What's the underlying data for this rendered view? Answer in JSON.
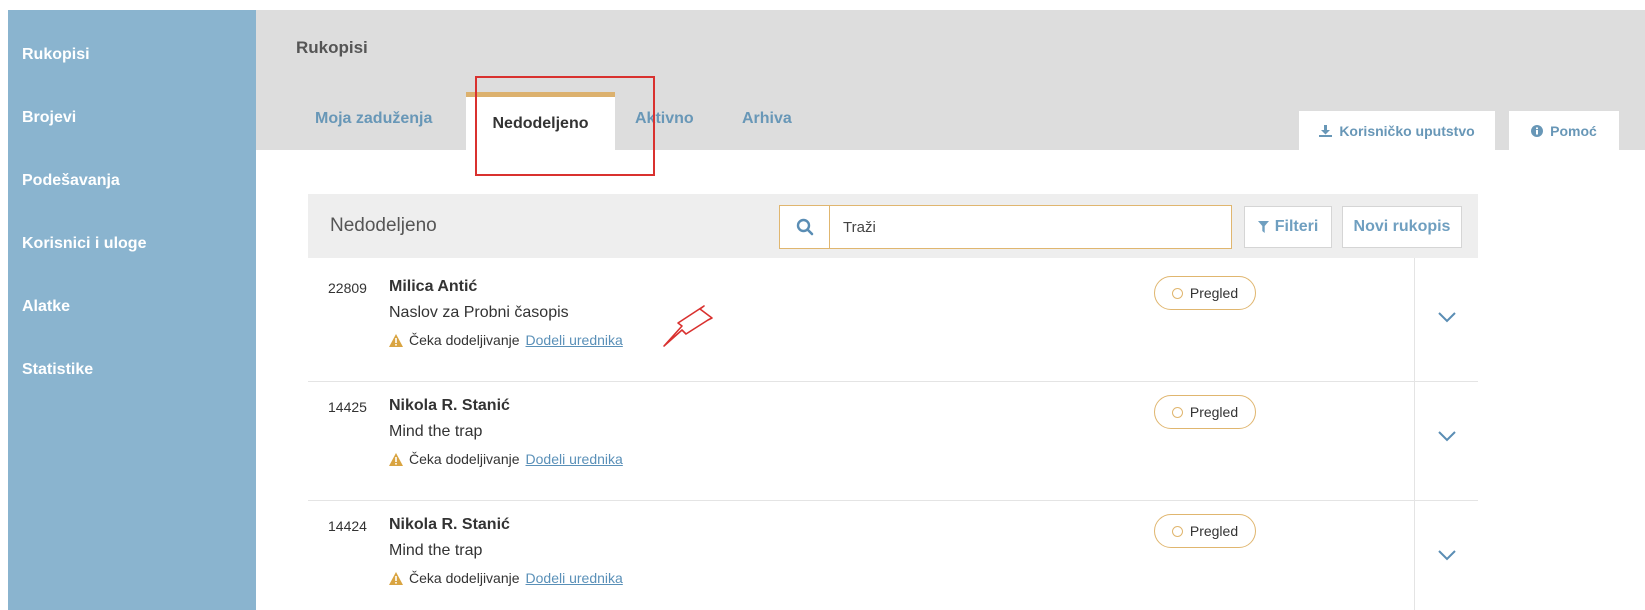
{
  "sidebar": {
    "items": [
      {
        "label": "Rukopisi"
      },
      {
        "label": "Brojevi"
      },
      {
        "label": "Podešavanja"
      },
      {
        "label": "Korisnici i uloge"
      },
      {
        "label": "Alatke"
      },
      {
        "label": "Statistike"
      }
    ]
  },
  "header": {
    "title": "Rukopisi",
    "tabs": [
      {
        "label": "Moja zaduženja"
      },
      {
        "label": "Nedodeljeno"
      },
      {
        "label": "Aktivno"
      },
      {
        "label": "Arhiva"
      }
    ],
    "guide_label": "Korisničko uputstvo",
    "help_label": "Pomoć"
  },
  "panel": {
    "title": "Nedodeljeno",
    "search_placeholder": "Traži",
    "filters_label": "Filteri",
    "new_label": "Novi rukopis"
  },
  "rows": [
    {
      "id": "22809",
      "author": "Milica Antić",
      "title": "Naslov za Probni časopis",
      "status": "Čeka dodeljivanje",
      "link": "Dodeli urednika",
      "badge": "Pregled"
    },
    {
      "id": "14425",
      "author": "Nikola R. Stanić",
      "title": "Mind the trap",
      "status": "Čeka dodeljivanje",
      "link": "Dodeli urednika",
      "badge": "Pregled"
    },
    {
      "id": "14424",
      "author": "Nikola R. Stanić",
      "title": "Mind the trap",
      "status": "Čeka dodeljivanje",
      "link": "Dodeli urednika",
      "badge": "Pregled"
    }
  ],
  "colors": {
    "sidebar": "#8ab4cf",
    "accent": "#dcb16e",
    "link": "#6897b7",
    "highlight": "#d9312f"
  }
}
